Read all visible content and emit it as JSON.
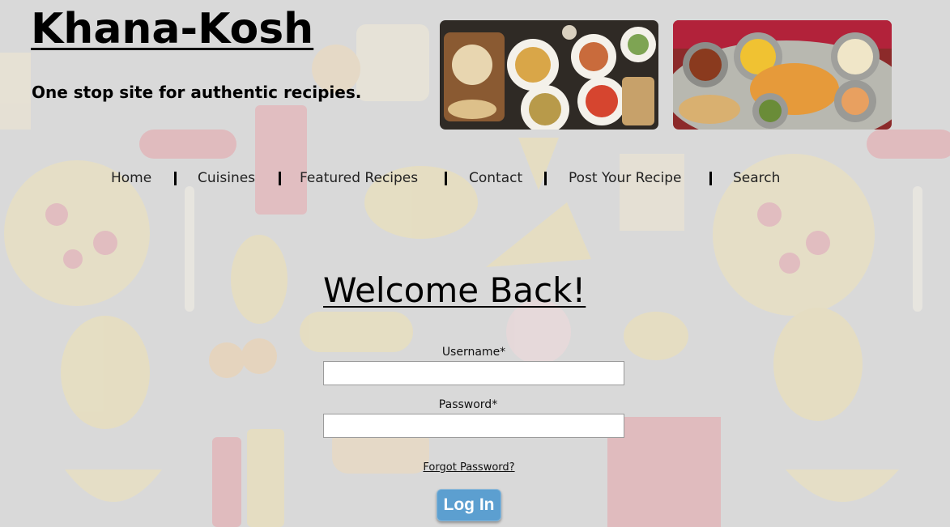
{
  "header": {
    "site_title": "Khana-Kosh",
    "tagline": "One stop site for authentic recipies."
  },
  "nav": {
    "items": [
      {
        "label": "Home"
      },
      {
        "label": "Cuisines"
      },
      {
        "label": "Featured Recipes"
      },
      {
        "label": "Contact"
      },
      {
        "label": "Post Your Recipe"
      },
      {
        "label": "Search"
      }
    ]
  },
  "login": {
    "heading": "Welcome Back!",
    "username_label": "Username*",
    "username_value": "",
    "password_label": "Password*",
    "password_value": "",
    "forgot_link": "Forgot Password?",
    "submit_label": "Log In"
  },
  "colors": {
    "background": "#d9d9d9",
    "button": "#5c9fd0",
    "text": "#000000"
  },
  "icons": [
    "food-platter-photo",
    "indian-thali-photo"
  ]
}
